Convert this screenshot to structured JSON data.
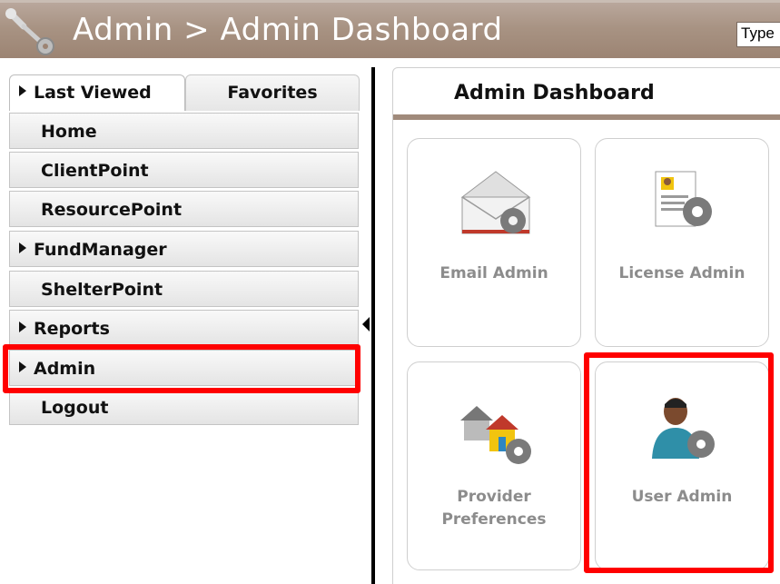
{
  "header": {
    "title": "Admin > Admin Dashboard",
    "search_placeholder": "Type",
    "icon": "wrench-gear-icon"
  },
  "nav": {
    "tabs": [
      {
        "label": "Last Viewed",
        "expandable": true,
        "active": true
      },
      {
        "label": "Favorites",
        "expandable": false,
        "active": false
      }
    ],
    "items": [
      {
        "label": "Home",
        "expandable": false
      },
      {
        "label": "ClientPoint",
        "expandable": false
      },
      {
        "label": "ResourcePoint",
        "expandable": false
      },
      {
        "label": "FundManager",
        "expandable": true
      },
      {
        "label": "ShelterPoint",
        "expandable": false
      },
      {
        "label": "Reports",
        "expandable": true
      },
      {
        "label": "Admin",
        "expandable": true,
        "highlighted": true
      },
      {
        "label": "Logout",
        "expandable": false
      }
    ]
  },
  "dashboard": {
    "title": "Admin Dashboard",
    "cards": [
      {
        "label": "Email Admin",
        "icon": "email-gear-icon"
      },
      {
        "label": "License Admin",
        "icon": "license-gear-icon"
      },
      {
        "label_lines": [
          "Provider",
          "Preferences"
        ],
        "icon": "houses-gear-icon"
      },
      {
        "label": "User Admin",
        "icon": "user-gear-icon",
        "highlighted": true
      }
    ]
  },
  "colors": {
    "header": "#a89383",
    "highlight": "#ff0000",
    "card_label": "#8c8c8c",
    "rule": "#a08a7b"
  }
}
